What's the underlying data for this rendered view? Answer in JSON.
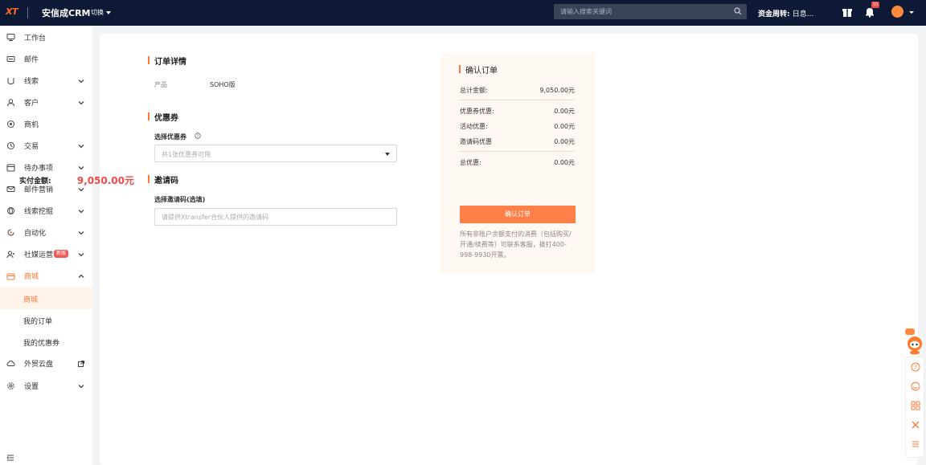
{
  "topbar": {
    "logo_text": "XT",
    "app_title": "安信成CRM",
    "switch_label": "切换",
    "search_placeholder": "请输入搜索关键词",
    "fund_label": "资金周转:",
    "fund_value": "日息...",
    "notification_badge": "10"
  },
  "sidebar": {
    "items": [
      {
        "label": "工作台",
        "icon": "monitor-icon"
      },
      {
        "label": "邮件",
        "icon": "mail-icon"
      },
      {
        "label": "线索",
        "icon": "magnet-icon"
      },
      {
        "label": "客户",
        "icon": "user-icon"
      },
      {
        "label": "商机",
        "icon": "opportunity-icon"
      },
      {
        "label": "交易",
        "icon": "clock-icon"
      },
      {
        "label": "待办事项",
        "icon": "calendar-icon"
      },
      {
        "label": "邮件营销",
        "icon": "mail-marketing-icon"
      },
      {
        "label": "线索挖掘",
        "icon": "globe-icon"
      },
      {
        "label": "自动化",
        "icon": "automation-icon"
      },
      {
        "label": "社媒运营",
        "icon": "social-icon",
        "tag": "新版"
      },
      {
        "label": "商城",
        "icon": "store-icon"
      }
    ],
    "store_sub": [
      "商城",
      "我的订单",
      "我的优惠券"
    ],
    "bottom_items": [
      {
        "label": "外贸云盘",
        "icon": "cloud-icon"
      },
      {
        "label": "设置",
        "icon": "gear-icon"
      }
    ]
  },
  "order": {
    "details_title": "订单详情",
    "product_label": "产品",
    "product_value": "SOHO版",
    "coupon_title": "优惠券",
    "coupon_field_label": "选择优惠券",
    "coupon_placeholder": "共1张优惠券可用",
    "invite_title": "邀请码",
    "invite_field_label": "选择邀请码(选填)",
    "invite_placeholder": "请提供Xtransfer合伙人提供的邀请码"
  },
  "confirm": {
    "title": "确认订单",
    "total_label": "总计金额:",
    "total_value": "9,050.00元",
    "coupon_discount_label": "优惠券优惠:",
    "coupon_discount_value": "0.00元",
    "activity_discount_label": "活动优惠:",
    "activity_discount_value": "0.00元",
    "invite_discount_label": "邀请码优惠",
    "invite_discount_value": "0.00元",
    "total_discount_label": "总优惠:",
    "total_discount_value": "0.00元",
    "pay_label": "实付金额:",
    "pay_value": "9,050.00元",
    "button_label": "确认订单",
    "note": "所有非账户余额支付的消费（包括购买/开通/续费等）可联系客服，拨打400-998-9930开票。"
  },
  "colors": {
    "accent": "#ff7a3a",
    "topbar": "#0e1a35",
    "price": "#f04b4b"
  }
}
